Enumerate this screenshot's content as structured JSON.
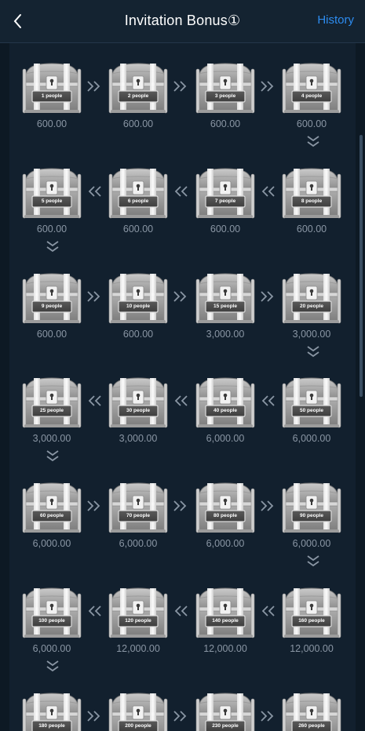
{
  "header": {
    "title": "Invitation Bonus①",
    "history_label": "History"
  },
  "chests": [
    {
      "label": "1 people",
      "amount": "600.00"
    },
    {
      "label": "2 people",
      "amount": "600.00"
    },
    {
      "label": "3 people",
      "amount": "600.00"
    },
    {
      "label": "4 people",
      "amount": "600.00"
    },
    {
      "label": "8 people",
      "amount": "600.00"
    },
    {
      "label": "7 people",
      "amount": "600.00"
    },
    {
      "label": "6 people",
      "amount": "600.00"
    },
    {
      "label": "5 people",
      "amount": "600.00"
    },
    {
      "label": "9 people",
      "amount": "600.00"
    },
    {
      "label": "10 people",
      "amount": "600.00"
    },
    {
      "label": "15 people",
      "amount": "3,000.00"
    },
    {
      "label": "20 people",
      "amount": "3,000.00"
    },
    {
      "label": "50 people",
      "amount": "6,000.00"
    },
    {
      "label": "40 people",
      "amount": "6,000.00"
    },
    {
      "label": "30 people",
      "amount": "3,000.00"
    },
    {
      "label": "25 people",
      "amount": "3,000.00"
    },
    {
      "label": "60 people",
      "amount": "6,000.00"
    },
    {
      "label": "70 people",
      "amount": "6,000.00"
    },
    {
      "label": "80 people",
      "amount": "6,000.00"
    },
    {
      "label": "90 people",
      "amount": "6,000.00"
    },
    {
      "label": "160 people",
      "amount": "12,000.00"
    },
    {
      "label": "140 people",
      "amount": "12,000.00"
    },
    {
      "label": "120 people",
      "amount": "12,000.00"
    },
    {
      "label": "100 people",
      "amount": "6,000.00"
    },
    {
      "label": "180 people",
      "amount": ""
    },
    {
      "label": "200 people",
      "amount": ""
    },
    {
      "label": "230 people",
      "amount": ""
    },
    {
      "label": "260 people",
      "amount": ""
    }
  ],
  "icons": {
    "back": "chevron-left-icon",
    "chest": "treasure-chest-icon",
    "arrow_right": "double-chevron-right-icon",
    "arrow_left": "double-chevron-left-icon",
    "arrow_down": "double-chevron-down-icon"
  },
  "colors": {
    "background": "#0f1d2b",
    "title": "#ffffff",
    "history": "#2d8cf0",
    "amount": "#8a96a4",
    "arrow": "#8a96a4"
  }
}
